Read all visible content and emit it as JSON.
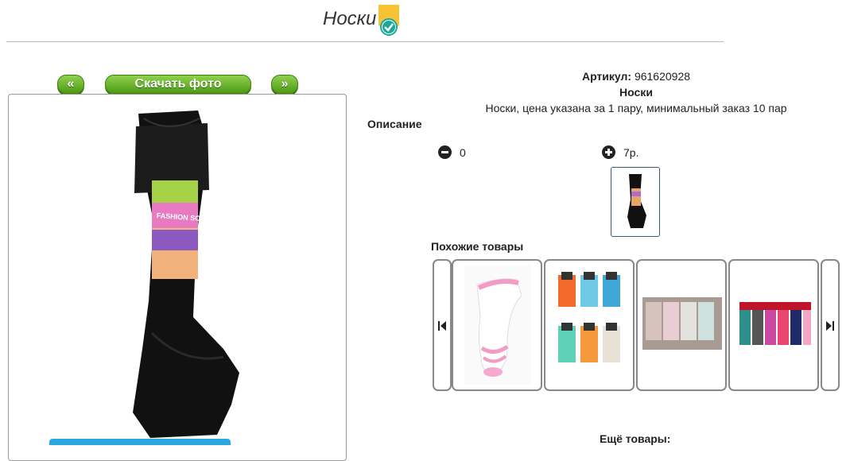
{
  "page": {
    "title": "Носки"
  },
  "photo_nav": {
    "prev_label": "«",
    "download_label": "Скачать фото",
    "next_label": "»"
  },
  "product": {
    "sku_label": "Артикул:",
    "sku": "961620928",
    "name": "Носки",
    "summary": "Носки, цена указана за 1 пару, минимальный заказ 10 пар",
    "package_text": "FASHION SOCKS МАРИНА"
  },
  "description_label": "Описание",
  "quantity": {
    "minus_value": "0",
    "plus_price": "7р."
  },
  "similar": {
    "label": "Похожие товары",
    "items": [
      "white-pink-socks",
      "colorful-socks-pack",
      "pastel-socks-boxed",
      "dark-pink-socks-row"
    ]
  },
  "more_label": "Ещё товары:",
  "colors": {
    "button_green": "#5fae22",
    "accent_blue": "#2aa7e0",
    "badge_yellow": "#f7c234",
    "badge_teal": "#1aa899"
  }
}
